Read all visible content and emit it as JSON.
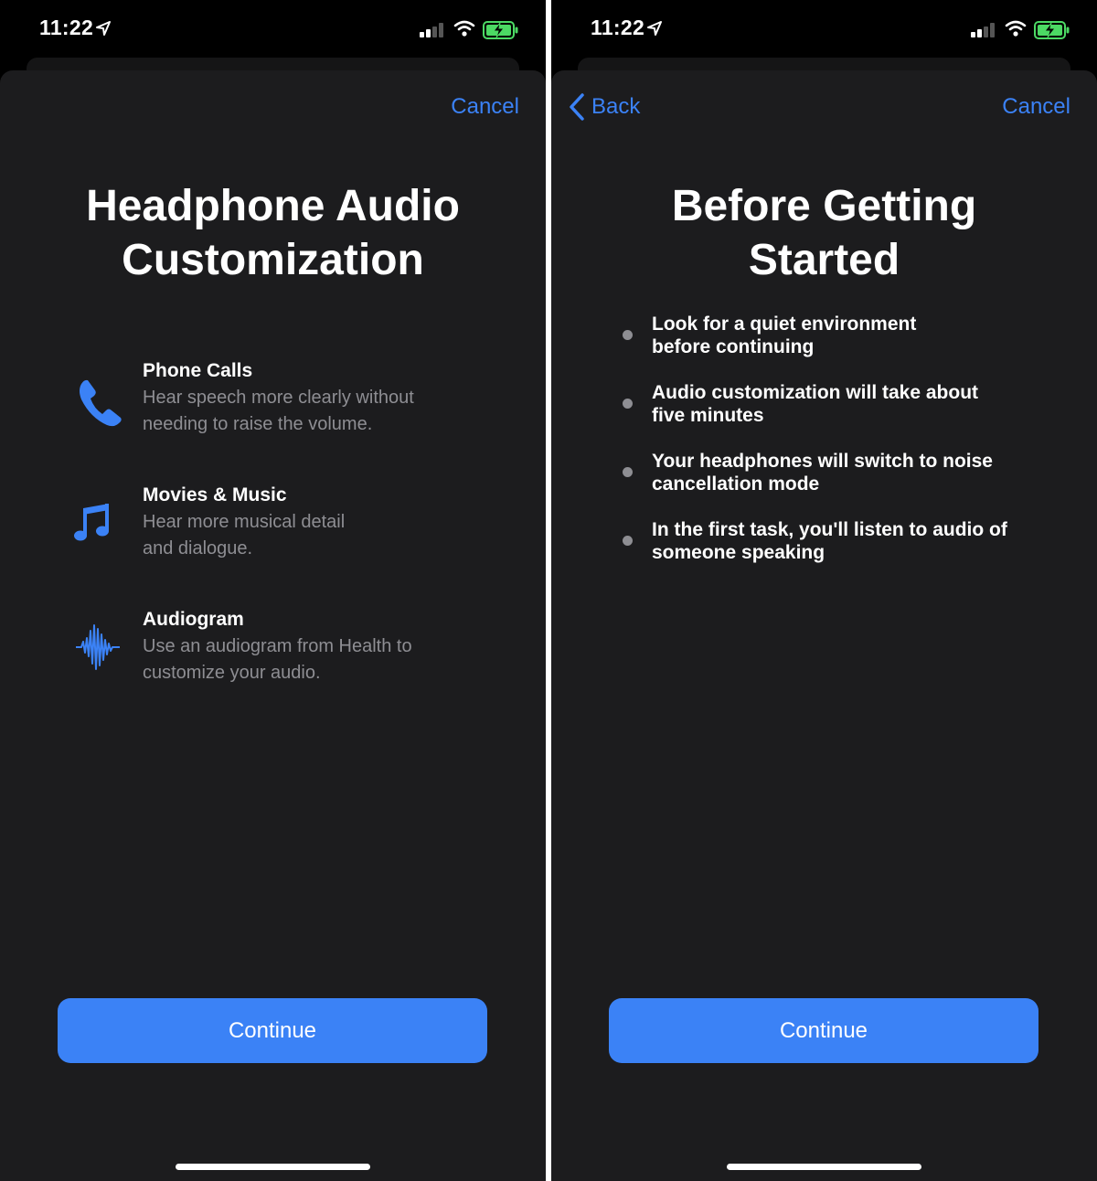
{
  "status_bar": {
    "time": "11:22"
  },
  "screens": [
    {
      "nav": {
        "cancel_label": "Cancel"
      },
      "title_line1": "Headphone Audio",
      "title_line2": "Customization",
      "features": [
        {
          "icon": "phone-icon",
          "title": "Phone Calls",
          "desc_line1": "Hear speech more clearly without",
          "desc_line2": "needing to raise the volume."
        },
        {
          "icon": "music-note-icon",
          "title": "Movies & Music",
          "desc_line1": "Hear more musical detail",
          "desc_line2": "and dialogue."
        },
        {
          "icon": "waveform-icon",
          "title": "Audiogram",
          "desc_line1": "Use an audiogram from Health to",
          "desc_line2": "customize your audio."
        }
      ],
      "continue_label": "Continue"
    },
    {
      "nav": {
        "back_label": "Back",
        "cancel_label": "Cancel"
      },
      "title_line1": "Before Getting",
      "title_line2": "Started",
      "bullets": [
        {
          "line1": "Look for a quiet environment",
          "line2": "before continuing"
        },
        {
          "line1": "Audio customization will take about",
          "line2": "five minutes"
        },
        {
          "line1": "Your headphones will switch to noise",
          "line2": "cancellation mode"
        },
        {
          "line1": "In the first task, you'll listen to audio of",
          "line2": "someone speaking"
        }
      ],
      "continue_label": "Continue"
    }
  ],
  "colors": {
    "accent": "#3b82f6",
    "sheet_bg": "#1c1c1e",
    "secondary_text": "#8e8e93",
    "battery_green": "#4cd964"
  }
}
